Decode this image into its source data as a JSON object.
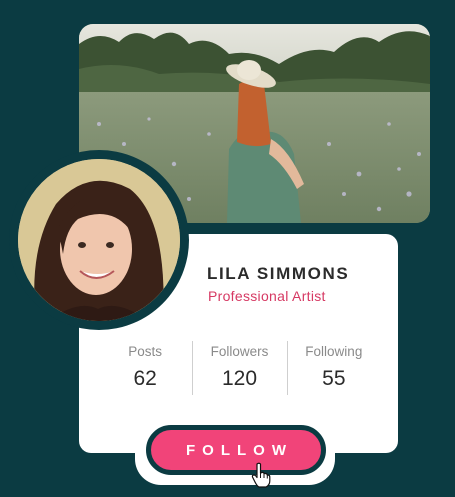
{
  "profile": {
    "name": "LILA SIMMONS",
    "role": "Professional Artist"
  },
  "stats": [
    {
      "label": "Posts",
      "value": "62"
    },
    {
      "label": "Followers",
      "value": "120"
    },
    {
      "label": "Following",
      "value": "55"
    }
  ],
  "follow_button": {
    "label": "FOLLOW"
  },
  "colors": {
    "background": "#0b3b42",
    "accent": "#f14479",
    "role_text": "#d63963",
    "card": "#ffffff"
  },
  "icons": [
    "hand-pointer-cursor-icon"
  ]
}
